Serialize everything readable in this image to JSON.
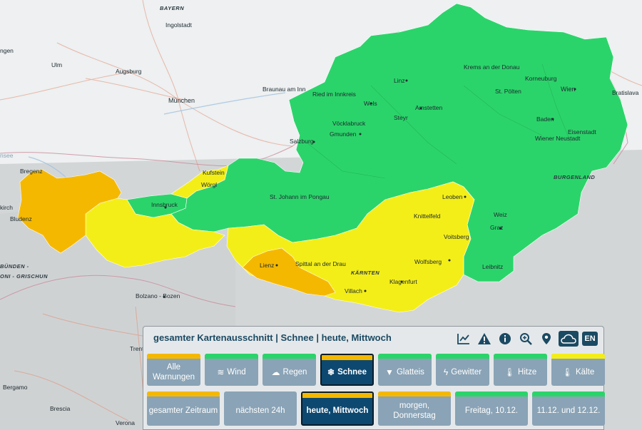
{
  "colors": {
    "green": "#2bd46a",
    "yellow": "#f4ee18",
    "orange": "#f5b800",
    "button_bg": "#8aa3b6",
    "button_active": "#0d4870",
    "title_text": "#1b4a63"
  },
  "map": {
    "cities": [
      {
        "name": "Ingolstadt"
      },
      {
        "name": "Ulm"
      },
      {
        "name": "Augsburg"
      },
      {
        "name": "München"
      },
      {
        "name": "Braunau am Inn"
      },
      {
        "name": "Ried im Innkreis"
      },
      {
        "name": "Wels"
      },
      {
        "name": "Linz"
      },
      {
        "name": "Krems an der Donau"
      },
      {
        "name": "Korneuburg"
      },
      {
        "name": "Wien"
      },
      {
        "name": "Bratislava"
      },
      {
        "name": "St. Pölten"
      },
      {
        "name": "Amstetten"
      },
      {
        "name": "Steyr"
      },
      {
        "name": "Vöcklabruck"
      },
      {
        "name": "Gmunden"
      },
      {
        "name": "Salzburg"
      },
      {
        "name": "Baden"
      },
      {
        "name": "Eisenstadt"
      },
      {
        "name": "Wiener Neustadt"
      },
      {
        "name": "Bregenz"
      },
      {
        "name": "Bludenz"
      },
      {
        "name": "Innsbruck"
      },
      {
        "name": "Kufstein"
      },
      {
        "name": "Wörgl"
      },
      {
        "name": "St. Johann im Pongau"
      },
      {
        "name": "Leoben"
      },
      {
        "name": "Knittelfeld"
      },
      {
        "name": "Weiz"
      },
      {
        "name": "Graz"
      },
      {
        "name": "Voitsberg"
      },
      {
        "name": "Wolfsberg"
      },
      {
        "name": "Leibnitz"
      },
      {
        "name": "Lienz"
      },
      {
        "name": "Spittal an der Drau"
      },
      {
        "name": "Klagenfurt"
      },
      {
        "name": "Villach"
      },
      {
        "name": "Bolzano - Bozen"
      },
      {
        "name": "Trento"
      },
      {
        "name": "Bergamo"
      },
      {
        "name": "Brescia"
      },
      {
        "name": "Verona"
      }
    ],
    "regions": [
      {
        "name": "BAYERN"
      },
      {
        "name": "BURGENLAND"
      },
      {
        "name": "KÄRNTEN"
      }
    ],
    "edge_labels": [
      "nsee",
      "kirch",
      "ngen",
      "BÜNDEN -",
      "ONI - GRISCHUN"
    ]
  },
  "panel": {
    "title": "gesamter Kartenausschnitt | Schnee | heute, Mittwoch",
    "tools": [
      {
        "icon": "chart-icon"
      },
      {
        "icon": "warning-icon"
      },
      {
        "icon": "info-icon"
      },
      {
        "icon": "zoom-icon"
      },
      {
        "icon": "location-pin-icon"
      },
      {
        "icon": "cloud-icon"
      }
    ],
    "lang_label": "EN",
    "types": [
      {
        "label": "Alle Warnungen",
        "level": "orange",
        "icon": ""
      },
      {
        "label": "Wind",
        "level": "green",
        "icon": "wind-icon"
      },
      {
        "label": "Regen",
        "level": "green",
        "icon": "rain-icon"
      },
      {
        "label": "Schnee",
        "level": "orange",
        "icon": "snowflake-icon",
        "active": true
      },
      {
        "label": "Glatteis",
        "level": "green",
        "icon": "ice-icon"
      },
      {
        "label": "Gewitter",
        "level": "green",
        "icon": "lightning-icon"
      },
      {
        "label": "Hitze",
        "level": "green",
        "icon": "thermometer-icon"
      },
      {
        "label": "Kälte",
        "level": "yellow",
        "icon": "thermometer-cold-icon"
      }
    ],
    "times": [
      {
        "label": "gesamter Zeitraum",
        "level": "orange"
      },
      {
        "label": "nächsten 24h",
        "level": "none"
      },
      {
        "label": "heute, Mittwoch",
        "level": "orange",
        "active": true
      },
      {
        "label": "morgen, Donnerstag",
        "level": "orange"
      },
      {
        "label": "Freitag, 10.12.",
        "level": "green"
      },
      {
        "label": "11.12. und 12.12.",
        "level": "green"
      }
    ]
  }
}
